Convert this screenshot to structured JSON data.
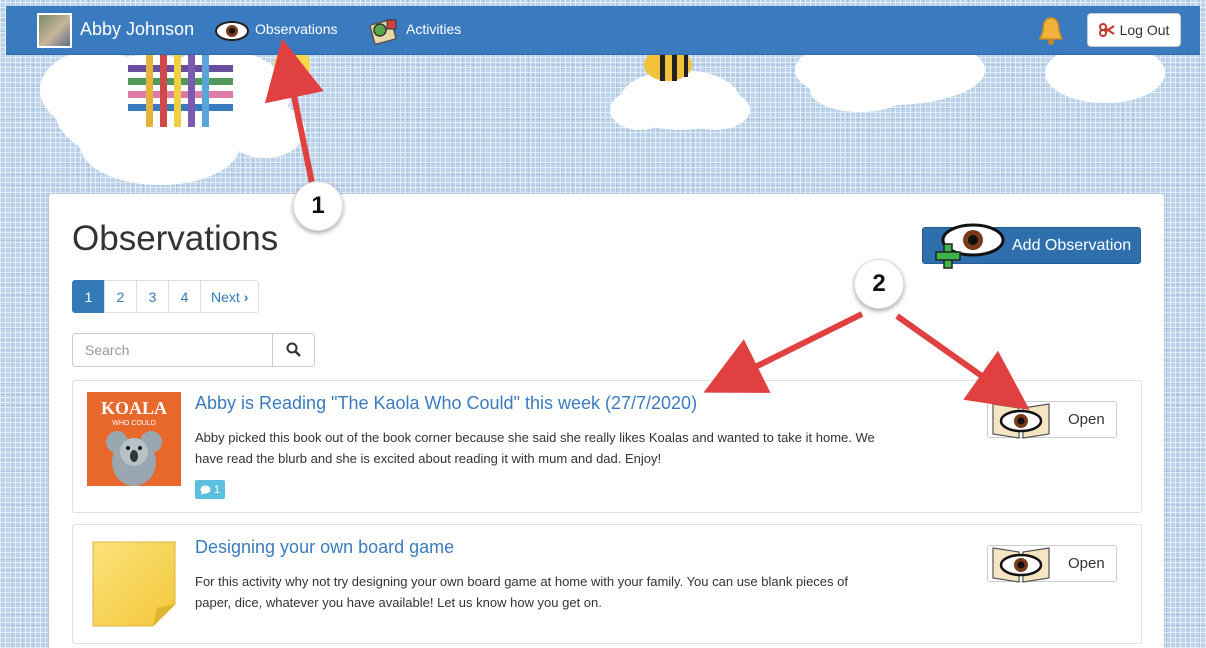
{
  "navbar": {
    "user_name": "Abby Johnson",
    "observations_label": "Observations",
    "activities_label": "Activities",
    "logout_label": "Log Out"
  },
  "page": {
    "title": "Observations",
    "add_button_label": "Add Observation"
  },
  "pagination": {
    "pages": [
      "1",
      "2",
      "3",
      "4"
    ],
    "active": "1",
    "next_label": "Next"
  },
  "search": {
    "placeholder": "Search"
  },
  "observations": [
    {
      "title": "Abby is Reading \"The Kaola Who Could\" this week (27/7/2020)",
      "description": "Abby picked this book out of the book corner because she said she really likes Koalas and wanted to take it home. We have read the blurb and she is excited about reading it with mum and dad. Enjoy!",
      "comment_count": "1",
      "thumbnail_text_top": "KOALA",
      "thumbnail_text_bottom": "WHO COULD",
      "open_label": "Open"
    },
    {
      "title": "Designing your own board game",
      "description": "For this activity why not try designing your own board game at home with your family. You can use blank pieces of paper, dice, whatever you have available! Let us know how you get on.",
      "open_label": "Open"
    }
  ],
  "annotations": {
    "marker_1": "1",
    "marker_2": "2"
  },
  "colors": {
    "navbar": "#3a7bbf",
    "link": "#3a7bbf",
    "primary_button": "#2f6fad",
    "arrow": "#e04040",
    "comment_badge": "#5bc0de"
  },
  "icons": {
    "observations": "eye-icon",
    "activities": "activities-icon",
    "notifications": "bell-icon",
    "logout": "scissors-icon",
    "search": "magnifier-icon",
    "open": "eye-book-icon",
    "add": "eye-plus-icon",
    "comment": "speech-bubble-icon"
  }
}
